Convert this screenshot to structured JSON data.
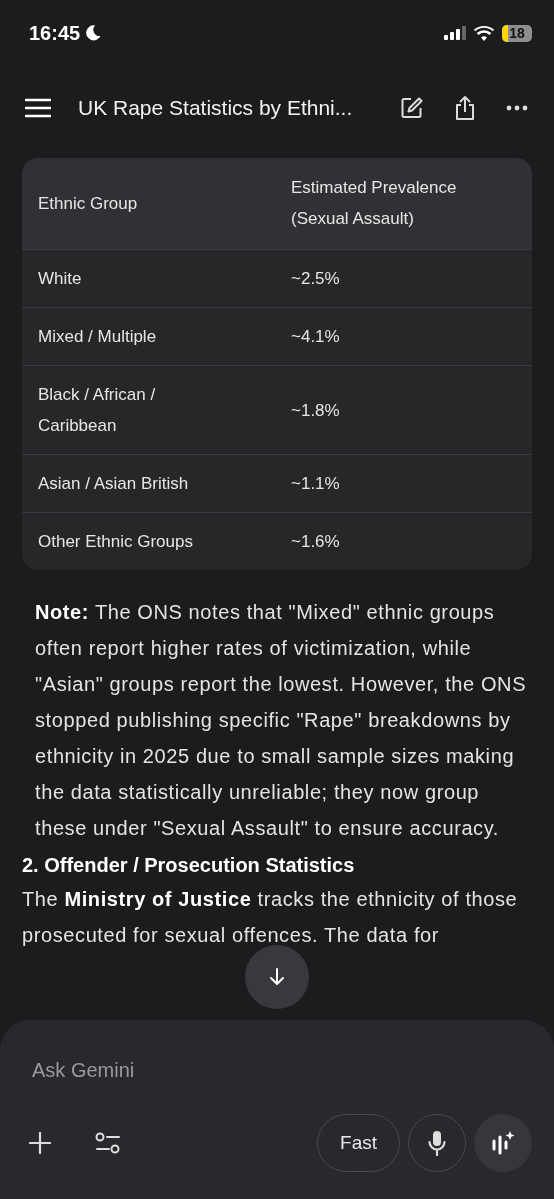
{
  "status_bar": {
    "time": "16:45",
    "battery": "18"
  },
  "header": {
    "title": "UK Rape Statistics by Ethni..."
  },
  "table": {
    "columns": [
      "Ethnic Group",
      "Estimated Prevalence (Sexual Assault)"
    ],
    "rows": [
      [
        "White",
        "~2.5%"
      ],
      [
        "Mixed / Multiple",
        "~4.1%"
      ],
      [
        "Black / African / Caribbean",
        "~1.8%"
      ],
      [
        "Asian / Asian British",
        "~1.1%"
      ],
      [
        "Other Ethnic Groups",
        "~1.6%"
      ]
    ]
  },
  "note": "**Note:** The ONS notes that \"Mixed\" ethnic groups often report higher rates of victimization, while \"Asian\" groups report the lowest. However, the ONS stopped publishing specific \"Rape\" breakdowns by ethnicity in 2025 due to small sample sizes making the data statistically unreliable; they now group these under \"Sexual Assault\" to ensure accuracy.",
  "section_heading": "2. Offender / Prosecution Statistics",
  "paragraph": "The **Ministry of Justice** tracks the ethnicity of those prosecuted for sexual offences. The data for",
  "composer": {
    "placeholder": "Ask Gemini",
    "mode_button": "Fast"
  }
}
